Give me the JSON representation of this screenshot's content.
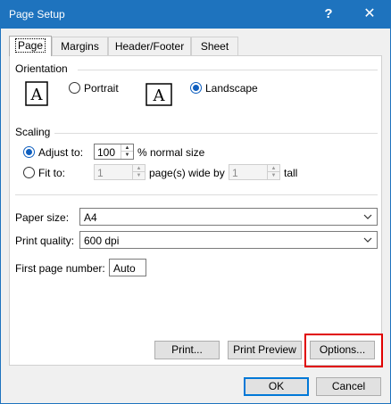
{
  "window": {
    "title": "Page Setup",
    "help_label": "?",
    "close_label": "✕"
  },
  "tabs": [
    {
      "label": "Page",
      "active": true
    },
    {
      "label": "Margins",
      "active": false
    },
    {
      "label": "Header/Footer",
      "active": false
    },
    {
      "label": "Sheet",
      "active": false
    }
  ],
  "orientation": {
    "heading": "Orientation",
    "portrait_label": "Portrait",
    "landscape_label": "Landscape",
    "selected": "landscape",
    "icon_letter": "A"
  },
  "scaling": {
    "heading": "Scaling",
    "adjust_to_label": "Adjust to:",
    "adjust_to_value": "100",
    "adjust_to_suffix": "% normal size",
    "fit_to_label": "Fit to:",
    "fit_wide_value": "1",
    "fit_wide_suffix": "page(s) wide by",
    "fit_tall_value": "1",
    "fit_tall_suffix": "tall",
    "selected": "adjust"
  },
  "paper": {
    "paper_size_label": "Paper size:",
    "paper_size_value": "A4",
    "print_quality_label": "Print quality:",
    "print_quality_value": "600 dpi",
    "first_page_label": "First page number:",
    "first_page_value": "Auto"
  },
  "buttons": {
    "print": "Print...",
    "print_preview": "Print Preview",
    "options": "Options...",
    "ok": "OK",
    "cancel": "Cancel"
  },
  "colors": {
    "titlebar": "#1e73be",
    "accent": "#0f5fbf",
    "highlight": "#e00000"
  }
}
